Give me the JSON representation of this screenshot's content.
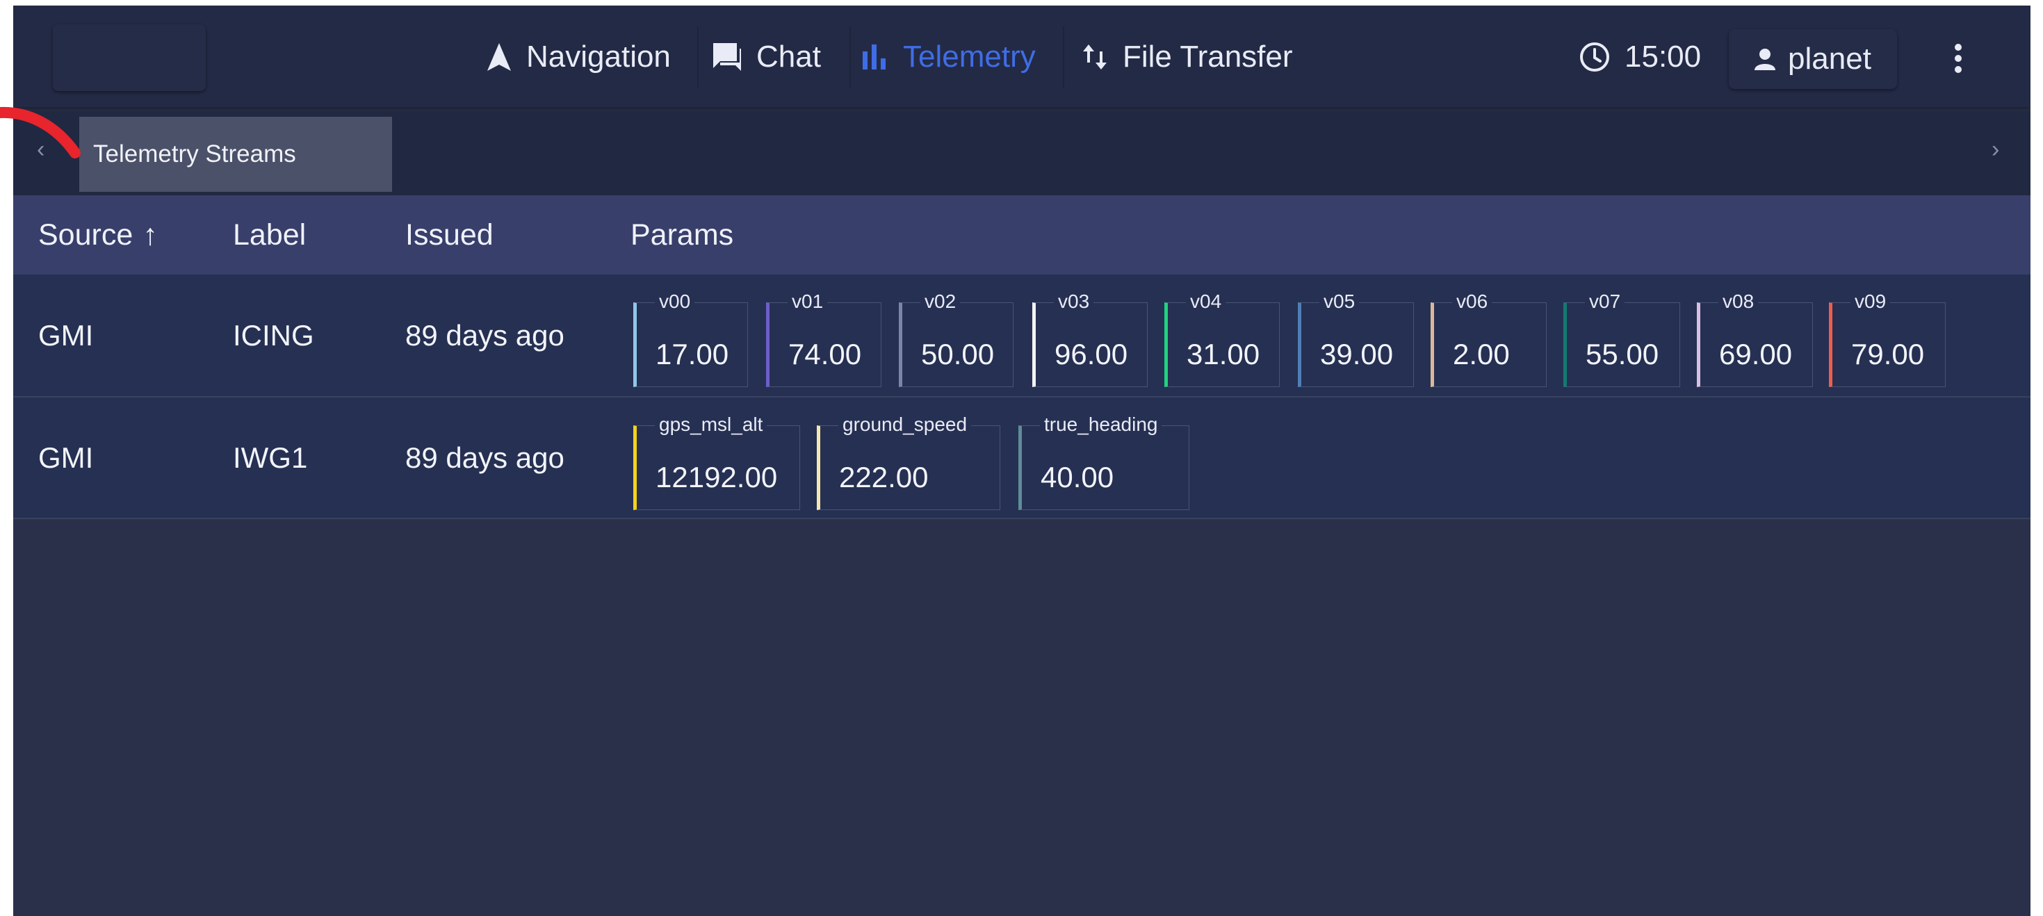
{
  "nav": {
    "items": [
      {
        "label": "Navigation",
        "icon": "navigation-arrow-icon",
        "active": false
      },
      {
        "label": "Chat",
        "icon": "chat-icon",
        "active": false
      },
      {
        "label": "Telemetry",
        "icon": "bar-chart-icon",
        "active": true
      },
      {
        "label": "File Transfer",
        "icon": "swap-vert-icon",
        "active": false
      }
    ],
    "clock": "15:00",
    "user": "planet"
  },
  "tabs": {
    "active_label": "Telemetry Streams"
  },
  "table": {
    "headers": {
      "source": "Source",
      "sort_indicator": "↑",
      "label": "Label",
      "issued": "Issued",
      "params": "Params"
    },
    "rows": [
      {
        "source": "GMI",
        "label": "ICING",
        "issued": "89 days ago",
        "params": [
          {
            "name": "v00",
            "value": "17.00",
            "color": "#8fc7e8"
          },
          {
            "name": "v01",
            "value": "74.00",
            "color": "#6c5fc9"
          },
          {
            "name": "v02",
            "value": "50.00",
            "color": "#7a86a8"
          },
          {
            "name": "v03",
            "value": "96.00",
            "color": "#f2f2f2"
          },
          {
            "name": "v04",
            "value": "31.00",
            "color": "#1fd47e"
          },
          {
            "name": "v05",
            "value": "39.00",
            "color": "#4f7fb5"
          },
          {
            "name": "v06",
            "value": "2.00",
            "color": "#d9b998"
          },
          {
            "name": "v07",
            "value": "55.00",
            "color": "#137a72"
          },
          {
            "name": "v08",
            "value": "69.00",
            "color": "#d8bfe0"
          },
          {
            "name": "v09",
            "value": "79.00",
            "color": "#ea5f50"
          }
        ]
      },
      {
        "source": "GMI",
        "label": "IWG1",
        "issued": "89 days ago",
        "params": [
          {
            "name": "gps_msl_alt",
            "value": "12192.00",
            "color": "#f5d21d"
          },
          {
            "name": "ground_speed",
            "value": "222.00",
            "color": "#f3e8b0"
          },
          {
            "name": "true_heading",
            "value": "40.00",
            "color": "#5f8c98"
          }
        ]
      }
    ]
  },
  "colors": {
    "accent": "#3f6de6",
    "background": "#2a3049",
    "topbar": "#232a45",
    "table_header": "#383f6a",
    "row": "#263052",
    "annotation_red": "#e8242c"
  }
}
